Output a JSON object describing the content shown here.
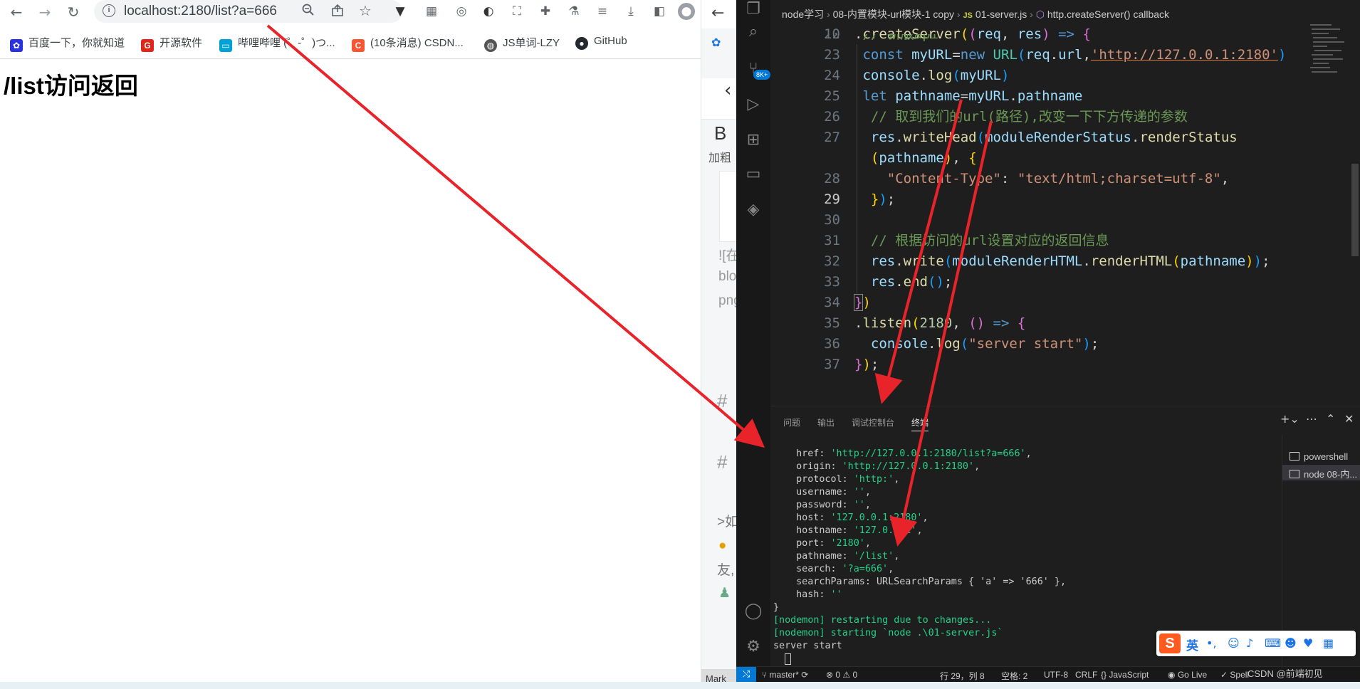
{
  "browser": {
    "url": "localhost:2180/list?a=666",
    "bookmarks": [
      {
        "label": "百度一下，你就知道",
        "color": "#2932e1"
      },
      {
        "label": "开源软件",
        "color": "#e1251b"
      },
      {
        "label": "哔哩哔哩 (゜-゜)つ...",
        "color": "#00a1d6"
      },
      {
        "label": "(10条消息) CSDN...",
        "color": "#fc5531"
      },
      {
        "label": "JS单词-LZY",
        "color": "#555555"
      },
      {
        "label": "GitHub",
        "color": "#24292f"
      }
    ],
    "page_heading": "/list访问返回"
  },
  "csdn": {
    "bold_label": "加粗",
    "b_glyph": "B",
    "snippets": [
      "![在",
      "blo",
      "png",
      "# ",
      "# ",
      ">如",
      "友,"
    ],
    "bottom_label": "Mark"
  },
  "vscode": {
    "breadcrumb": {
      "folder1": "node学习",
      "folder2": "08-内置模块-url模块-1 copy",
      "file": "01-server.js",
      "symbol": "http.createServer() callback"
    },
    "activity_badge": "8K+",
    "panel_tabs": [
      "问题",
      "输出",
      "调试控制台",
      "终端"
    ],
    "active_panel_tab": "终端",
    "terminals": [
      "powershell",
      "node 08-内..."
    ],
    "terminal_lines": [
      {
        "key": "href",
        "value": "'http://127.0.0.1:2180/list?a=666'"
      },
      {
        "key": "origin",
        "value": "'http://127.0.0.1:2180'"
      },
      {
        "key": "protocol",
        "value": "'http:'"
      },
      {
        "key": "username",
        "value": "''"
      },
      {
        "key": "password",
        "value": "''"
      },
      {
        "key": "host",
        "value": "'127.0.0.1:2180'"
      },
      {
        "key": "hostname",
        "value": "'127.0.0.1'"
      },
      {
        "key": "port",
        "value": "'2180'"
      },
      {
        "key": "pathname",
        "value": "'/list'"
      },
      {
        "key": "search",
        "value": "'?a=666'"
      },
      {
        "key": "searchParams",
        "value": "URLSearchParams { 'a' => '666' }"
      },
      {
        "key": "hash",
        "value": "''"
      }
    ],
    "terminal_tail": [
      "}",
      "[nodemon] restarting due to changes...",
      "[nodemon] starting `node .\\01-server.js`",
      "server start"
    ],
    "status": {
      "branch": "master*",
      "problems": "⊗ 0 ⚠ 0",
      "position": "行 29，列 8",
      "spaces": "空格: 2",
      "encoding": "UTF-8",
      "eol": "CRLF",
      "language": "{} JavaScript",
      "golive": "Go Live",
      "spell": "✓ Spell"
    },
    "ime_lang": "英",
    "watermark": "CSDN @前端初见"
  }
}
